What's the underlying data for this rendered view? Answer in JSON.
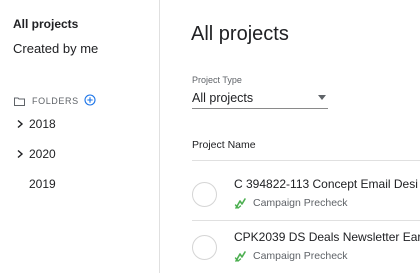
{
  "sidebar": {
    "all_projects": "All projects",
    "created_by_me": "Created by me",
    "folders_label": "FOLDERS",
    "folders": [
      {
        "name": "2018",
        "expandable": true
      },
      {
        "name": "2020",
        "expandable": true
      },
      {
        "name": "2019",
        "expandable": false
      }
    ]
  },
  "main": {
    "title": "All projects",
    "filter": {
      "label": "Project Type",
      "value": "All projects"
    },
    "column_header": "Project Name",
    "rows": [
      {
        "name": "C 394822-113 Concept Email Desi",
        "type": "Campaign Precheck"
      },
      {
        "name": "CPK2039 DS Deals Newsletter Ear",
        "type": "Campaign Precheck"
      }
    ]
  },
  "colors": {
    "accent": "#1a73e8",
    "type_icon": "#4caf50",
    "divider": "#e0e0e0"
  },
  "icons": {
    "folder": "folder-icon",
    "add": "add-circle-icon",
    "chevron": "chevron-right-icon",
    "caret": "caret-down-icon",
    "type": "campaign-precheck-icon"
  }
}
